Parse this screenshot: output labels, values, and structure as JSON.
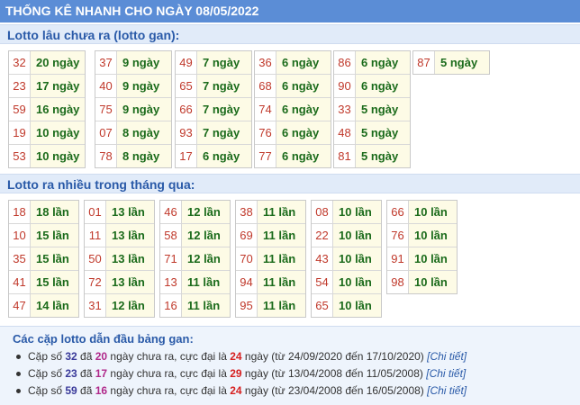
{
  "header": {
    "title": "THỐNG KÊ NHANH CHO NGÀY 08/05/2022"
  },
  "gan": {
    "title": "Lotto lâu chưa ra (lotto gan):",
    "columns": [
      [
        {
          "n": "32",
          "v": "20 ngày"
        },
        {
          "n": "23",
          "v": "17 ngày"
        },
        {
          "n": "59",
          "v": "16 ngày"
        },
        {
          "n": "19",
          "v": "10 ngày"
        },
        {
          "n": "53",
          "v": "10 ngày"
        }
      ],
      [
        {
          "n": "37",
          "v": "9 ngày"
        },
        {
          "n": "40",
          "v": "9 ngày"
        },
        {
          "n": "75",
          "v": "9 ngày"
        },
        {
          "n": "07",
          "v": "8 ngày"
        },
        {
          "n": "78",
          "v": "8 ngày"
        }
      ],
      [
        {
          "n": "49",
          "v": "7 ngày"
        },
        {
          "n": "65",
          "v": "7 ngày"
        },
        {
          "n": "66",
          "v": "7 ngày"
        },
        {
          "n": "93",
          "v": "7 ngày"
        },
        {
          "n": "17",
          "v": "6 ngày"
        }
      ],
      [
        {
          "n": "36",
          "v": "6 ngày"
        },
        {
          "n": "68",
          "v": "6 ngày"
        },
        {
          "n": "74",
          "v": "6 ngày"
        },
        {
          "n": "76",
          "v": "6 ngày"
        },
        {
          "n": "77",
          "v": "6 ngày"
        }
      ],
      [
        {
          "n": "86",
          "v": "6 ngày"
        },
        {
          "n": "90",
          "v": "6 ngày"
        },
        {
          "n": "33",
          "v": "5 ngày"
        },
        {
          "n": "48",
          "v": "5 ngày"
        },
        {
          "n": "81",
          "v": "5 ngày"
        }
      ],
      [
        {
          "n": "87",
          "v": "5 ngày"
        }
      ]
    ]
  },
  "nhieu": {
    "title": "Lotto ra nhiều trong tháng qua:",
    "columns": [
      [
        {
          "n": "18",
          "v": "18 lần"
        },
        {
          "n": "10",
          "v": "15 lần"
        },
        {
          "n": "35",
          "v": "15 lần"
        },
        {
          "n": "41",
          "v": "15 lần"
        },
        {
          "n": "47",
          "v": "14 lần"
        }
      ],
      [
        {
          "n": "01",
          "v": "13 lần"
        },
        {
          "n": "11",
          "v": "13 lần"
        },
        {
          "n": "50",
          "v": "13 lần"
        },
        {
          "n": "72",
          "v": "13 lần"
        },
        {
          "n": "31",
          "v": "12 lần"
        }
      ],
      [
        {
          "n": "46",
          "v": "12 lần"
        },
        {
          "n": "58",
          "v": "12 lần"
        },
        {
          "n": "71",
          "v": "12 lần"
        },
        {
          "n": "13",
          "v": "11 lần"
        },
        {
          "n": "16",
          "v": "11 lần"
        }
      ],
      [
        {
          "n": "38",
          "v": "11 lần"
        },
        {
          "n": "69",
          "v": "11 lần"
        },
        {
          "n": "70",
          "v": "11 lần"
        },
        {
          "n": "94",
          "v": "11 lần"
        },
        {
          "n": "95",
          "v": "11 lần"
        }
      ],
      [
        {
          "n": "08",
          "v": "10 lần"
        },
        {
          "n": "22",
          "v": "10 lần"
        },
        {
          "n": "43",
          "v": "10 lần"
        },
        {
          "n": "54",
          "v": "10 lần"
        },
        {
          "n": "65",
          "v": "10 lần"
        }
      ],
      [
        {
          "n": "66",
          "v": "10 lần"
        },
        {
          "n": "76",
          "v": "10 lần"
        },
        {
          "n": "91",
          "v": "10 lần"
        },
        {
          "n": "98",
          "v": "10 lần"
        }
      ]
    ]
  },
  "pairs": {
    "title": "Các cặp lotto dẫn đầu bảng gan:",
    "items": [
      {
        "p1": "Cặp số ",
        "pair": "32",
        "p2": " đã ",
        "days": "20",
        "p3": " ngày chưa ra, cực đại là ",
        "max": "24",
        "p4": " ngày (từ 24/09/2020 đến 17/10/2020) ",
        "link": "[Chi tiết]"
      },
      {
        "p1": "Cặp số ",
        "pair": "23",
        "p2": " đã ",
        "days": "17",
        "p3": " ngày chưa ra, cực đại là ",
        "max": "29",
        "p4": " ngày (từ 13/04/2008 đến 11/05/2008) ",
        "link": "[Chi tiết]"
      },
      {
        "p1": "Cặp số ",
        "pair": "59",
        "p2": " đã ",
        "days": "16",
        "p3": " ngày chưa ra, cực đại là ",
        "max": "24",
        "p4": " ngày (từ 23/04/2008 đến 16/05/2008) ",
        "link": "[Chi tiết]"
      }
    ]
  }
}
